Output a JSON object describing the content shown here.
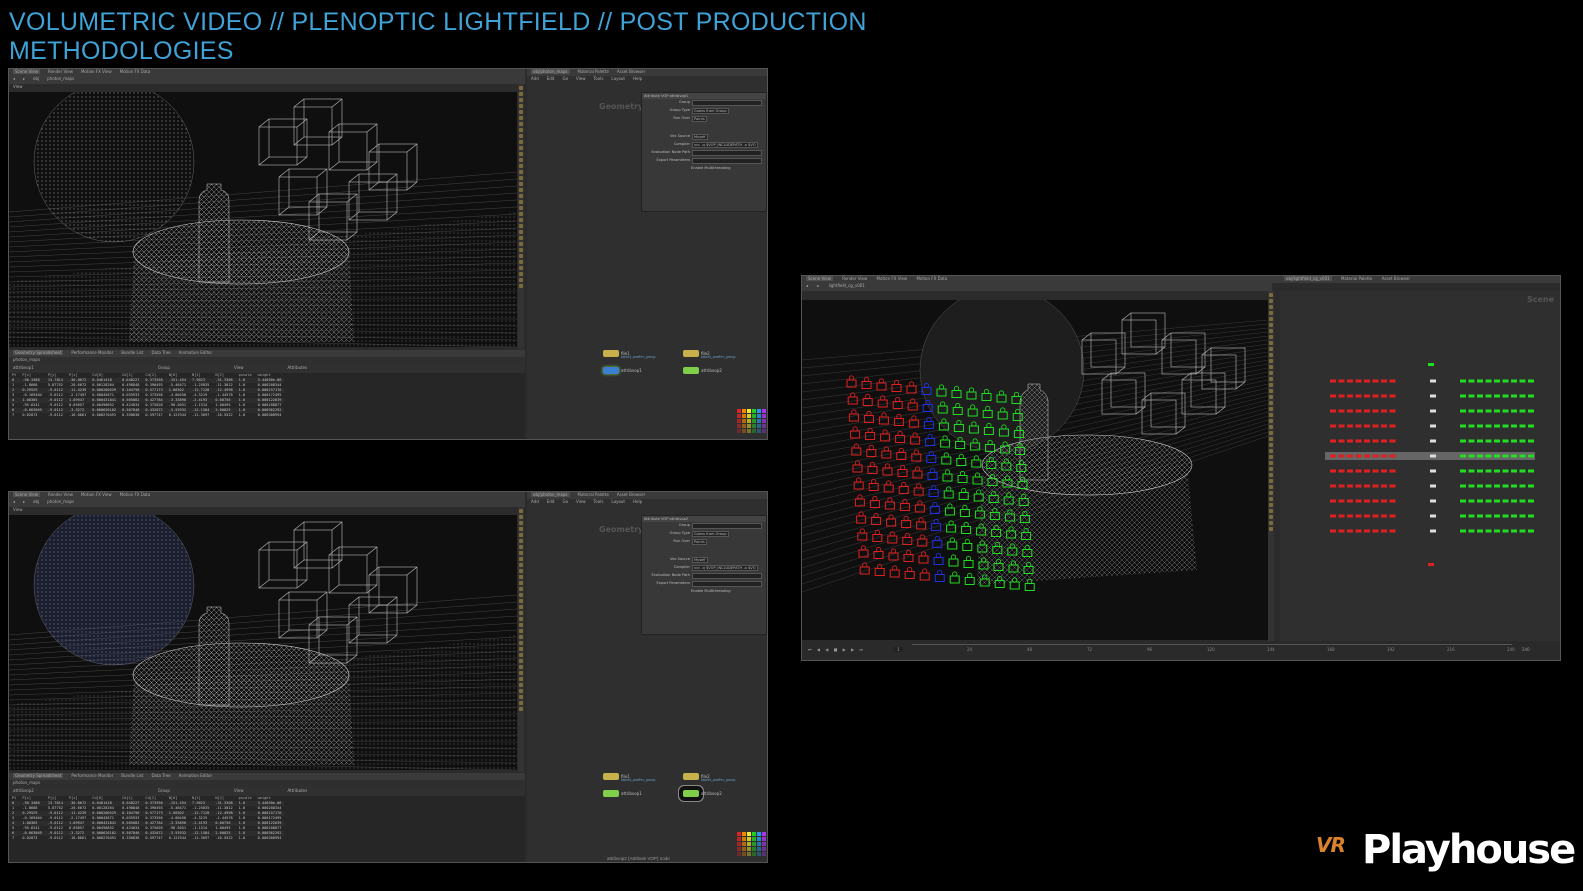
{
  "title": {
    "part1": "VOLUMETRIC VIDEO",
    "sep": "//",
    "part2": "PLENOPTIC LIGHTFIELD",
    "part3": "POST PRODUCTION",
    "line2": "METHODOLOGIES"
  },
  "window_top": {
    "viewport_tabs": [
      "Scene View",
      "Render View",
      "Motion FX View",
      "Motion FX Data"
    ],
    "path": "obj",
    "node_path": "photon_maps",
    "view_label": "View",
    "net_tabs": [
      "obj/photon_maps",
      "Material Palette",
      "Asset Browser"
    ],
    "net_menu": [
      "Add",
      "Edit",
      "Go",
      "View",
      "Tools",
      "Layout",
      "Help"
    ],
    "net_context": "Geometry",
    "param_header": "Attribute VOP  attribvop1",
    "params": [
      {
        "k": "Group",
        "v": ""
      },
      {
        "k": "Group Type",
        "v": "Guess from Group"
      },
      {
        "k": "Run Over",
        "v": "Points"
      },
      {
        "k": "Vex Source",
        "v": "Myself"
      },
      {
        "k": "Compiler",
        "v": "vcc -q $VOP_INCLUDEPATH -o $VO"
      },
      {
        "k": "Evaluation Node Path",
        "v": ""
      },
      {
        "k": "Export Parameters",
        "v": ""
      },
      {
        "k": "",
        "v": "Enable Multithreading"
      }
    ],
    "nodes": [
      {
        "name": "file1",
        "sub": "tablet_proffer_group",
        "kind": "file"
      },
      {
        "name": "attribvop1",
        "sub": "",
        "kind": "vop"
      },
      {
        "name": "file2",
        "sub": "tablet_proffer_group",
        "kind": "file"
      },
      {
        "name": "attribvop2",
        "sub": "",
        "kind": "vop"
      }
    ],
    "sheet_tabs": [
      "Geometry Spreadsheet",
      "Performance Monitor",
      "Bundle List",
      "Data Tree",
      "Animation Editor"
    ],
    "sheet_node": "attribvop1",
    "sheet_group_label": "Group",
    "sheet_view_label": "View",
    "sheet_attr_label": "Attributes"
  },
  "window_bottom": {
    "node_path": "photon_maps",
    "param_header": "Attribute VOP  attribvop2",
    "sheet_node": "attribvop2",
    "status": "attribvop2 (Attribute VOP) node"
  },
  "window_right": {
    "viewport_tabs": [
      "Scene View",
      "Render View",
      "Motion FX View",
      "Motion FX Data"
    ],
    "node_path": "lightfield_cg_v001",
    "net_tabs": [
      "obj/lightfield_cg_v001",
      "Material Palette",
      "Asset Browser"
    ],
    "net_context": "Scene",
    "timeline_frame": "1",
    "timeline_ticks": [
      "24",
      "48",
      "72",
      "96",
      "120",
      "144",
      "168",
      "192",
      "216",
      "240"
    ],
    "end_frame": "240"
  },
  "spreadsheet": {
    "headers": [
      "Pt",
      "P[x]",
      "P[y]",
      "P[z]",
      "Cd[0]",
      "Cd[1]",
      "Cd[2]",
      "N[0]",
      "N[1]",
      "N[2]",
      "pscale",
      "weight"
    ],
    "rows": [
      [
        "0",
        "-56.3488",
        "13.7814",
        "-36.0672",
        "0.0461418",
        "0.648227",
        "0.373558",
        "-151.454",
        "7.9023",
        "-31.3308",
        "1.0",
        "3.44050e-06"
      ],
      [
        "1",
        "-1.8668",
        "5.87752",
        "-20.6672",
        "0.00128264",
        "0.498848",
        "0.390493",
        "-5.46471",
        "-1.25835",
        "-11.3812",
        "1.0",
        "0.000208344"
      ],
      [
        "2",
        "0.29529",
        "-9.0112",
        "-11.4239",
        "0.000200529",
        "0.104798",
        "0.577173",
        "1.08302",
        "-12.7128",
        "-12.4998",
        "1.0",
        "0.000157176"
      ],
      [
        "3",
        "-0.169404",
        "-9.0112",
        "-2.17497",
        "0.00045671",
        "0.035933",
        "0.373558",
        "-4.00450",
        "-4.3219",
        "-1.44578",
        "1.0",
        "0.000172495"
      ],
      [
        "4",
        "1.00365",
        "-9.0112",
        "1.89947",
        "0.000431841",
        "0.505082",
        "0.427784",
        "-3.33890",
        "-2.4193",
        "0.00756",
        "1.0",
        "0.000122639"
      ],
      [
        "5",
        "-95.6241",
        "-9.0112",
        "0.65057",
        "0.00490852",
        "0.424034",
        "0.375028",
        "-98.5051",
        "-1.1314",
        "1.00495",
        "1.0",
        "0.000188877"
      ],
      [
        "6",
        "-0.663069",
        "-9.0112",
        "-3.3272",
        "0.000626102",
        "0.507846",
        "0.432072",
        "-3.53932",
        "-12.1584",
        "2.00025",
        "1.0",
        "0.000362292"
      ],
      [
        "7",
        "0.02073",
        "-9.0112",
        "-16.0661",
        "0.000270491",
        "0.350838",
        "0.597747",
        "0.121944",
        "-11.3697",
        "-16.5522",
        "1.0",
        "0.000300994"
      ]
    ]
  },
  "logo": {
    "vr": "VR",
    "name": "Playhouse"
  },
  "colors": {
    "title": "#3fa3d8",
    "background": "#000000",
    "node_file": "#c8b04a",
    "node_vop": "#7fcf4a",
    "cam_red": "#e02020",
    "cam_green": "#22dd22",
    "cam_blue": "#2030e0",
    "logo_orange": "#d9822b"
  }
}
